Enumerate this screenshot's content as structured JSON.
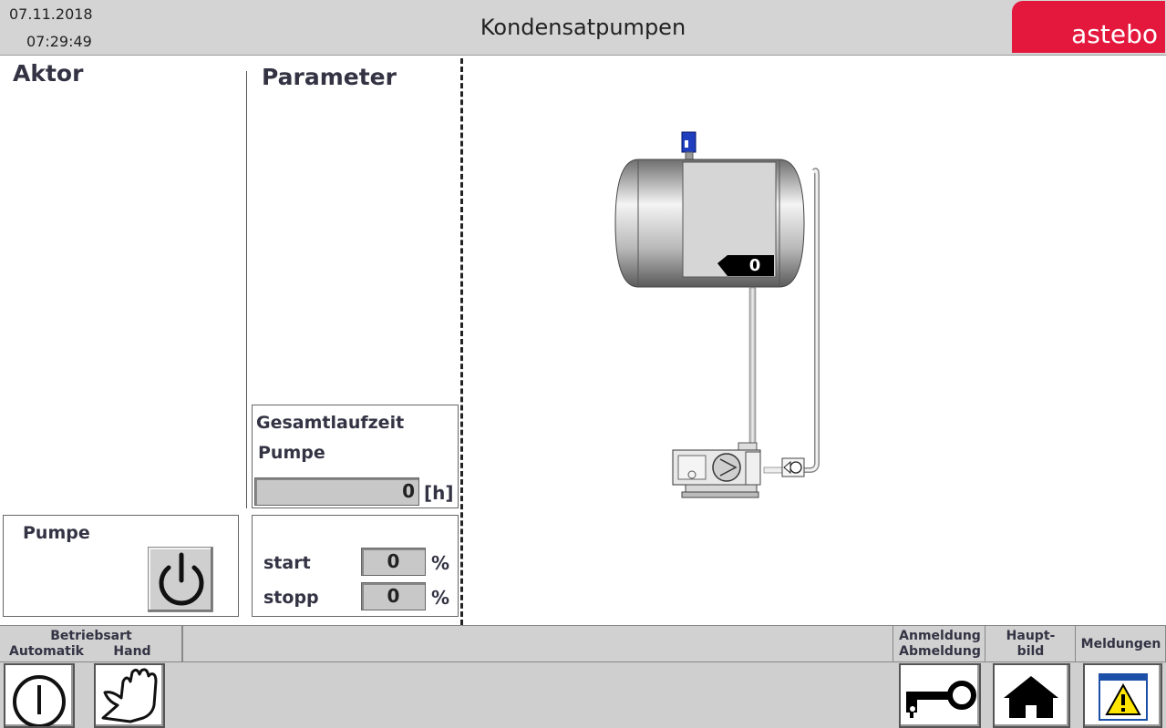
{
  "header": {
    "date": "07.11.2018",
    "time": "07:29:49",
    "title": "Kondensatpumpen",
    "logo": "astebo",
    "logo_color": "#e4173d"
  },
  "aktor": {
    "title": "Aktor",
    "pump_label": "Pumpe",
    "pump_button_icon": "power-icon"
  },
  "parameter": {
    "title": "Parameter",
    "runtime_label_1": "Gesamtlaufzeit",
    "runtime_label_2": "Pumpe",
    "runtime_value": "0",
    "runtime_unit": "[h]",
    "start_label": "start",
    "start_value": "0",
    "stop_label": "stopp",
    "stop_value": "0",
    "percent": "%"
  },
  "diagram": {
    "tank_level": "0"
  },
  "footer": {
    "mode_title": "Betriebsart",
    "mode_auto": "Automatik",
    "mode_hand": "Hand",
    "login_1": "Anmeldung",
    "login_2": "Abmeldung",
    "home_1": "Haupt-",
    "home_2": "bild",
    "messages": "Meldungen",
    "icons": [
      "power-icon",
      "hand-icon",
      "key-icon",
      "home-icon",
      "warning-icon"
    ]
  }
}
